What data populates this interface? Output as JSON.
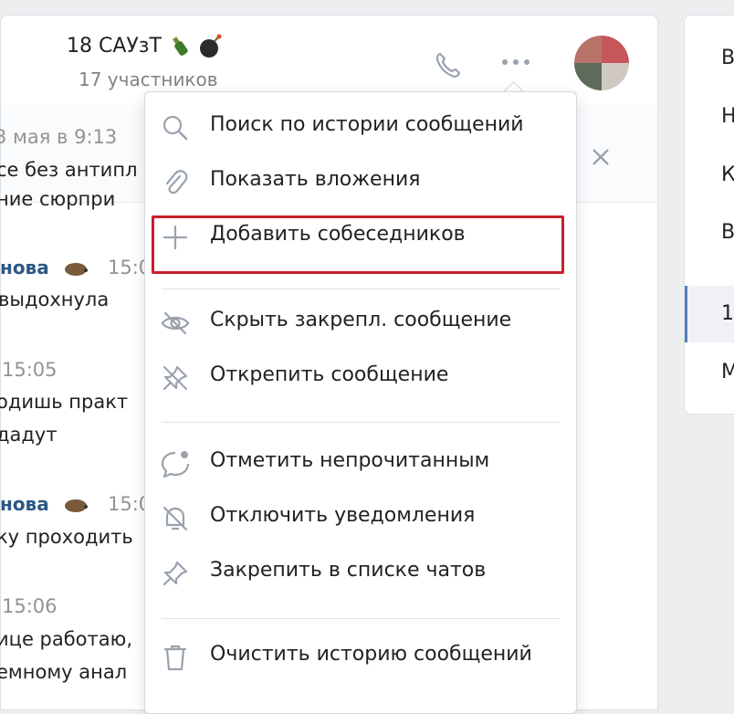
{
  "chat": {
    "title": "18 САУзТ",
    "participants": "17 участников"
  },
  "messages": [
    {
      "kind": "time",
      "text": "3 мая в 9:13"
    },
    {
      "kind": "text",
      "text": "се без антипл"
    },
    {
      "kind": "text",
      "text": "ние сюрпри"
    },
    {
      "kind": "author",
      "text": "нова"
    },
    {
      "kind": "time",
      "text": "15:0"
    },
    {
      "kind": "text",
      "text": "выдохнула"
    },
    {
      "kind": "time",
      "text": "15:05"
    },
    {
      "kind": "text",
      "text": "одишь практ"
    },
    {
      "kind": "text",
      "text": "дадут"
    },
    {
      "kind": "author",
      "text": "нова"
    },
    {
      "kind": "time",
      "text": "15:0"
    },
    {
      "kind": "text",
      "text": "ку проходить"
    },
    {
      "kind": "time",
      "text": "15:06"
    },
    {
      "kind": "text",
      "text": "ице работаю,"
    },
    {
      "kind": "text",
      "text": "емному анал"
    }
  ],
  "side_panel": {
    "items": [
      "В",
      "Н",
      "К",
      "В",
      "1",
      "М"
    ]
  },
  "menu": {
    "items": [
      {
        "label": "Поиск по истории сообщений",
        "icon": "search-icon"
      },
      {
        "label": "Показать вложения",
        "icon": "paperclip-icon"
      },
      {
        "label": "Добавить собеседников",
        "icon": "plus-icon"
      },
      {
        "label": "Скрыть закрепл. сообщение",
        "icon": "eye-off-icon"
      },
      {
        "label": "Открепить сообщение",
        "icon": "unpin-icon"
      },
      {
        "label": "Отметить непрочитанным",
        "icon": "unread-bubble-icon"
      },
      {
        "label": "Отключить уведомления",
        "icon": "mute-icon"
      },
      {
        "label": "Закрепить в списке чатов",
        "icon": "pin-icon"
      },
      {
        "label": "Очистить историю сообщений",
        "icon": "trash-icon"
      }
    ]
  },
  "colors": {
    "accent": "#5181b8",
    "highlight": "#c8202b",
    "author": "#2a5885"
  }
}
